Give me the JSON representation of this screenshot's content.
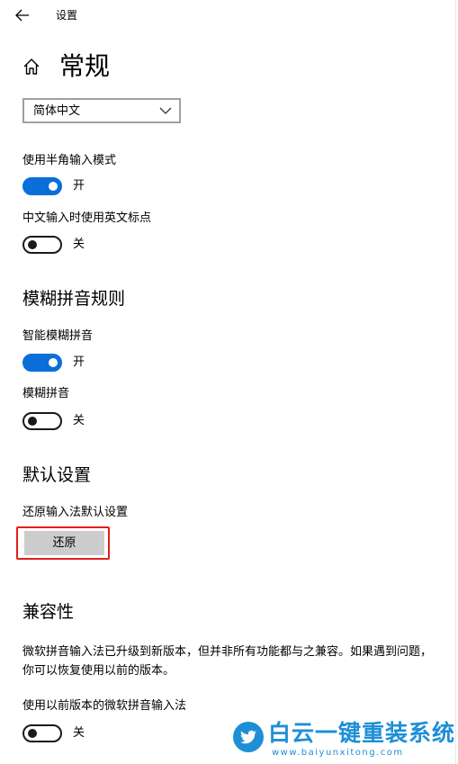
{
  "window": {
    "title": "设置"
  },
  "page": {
    "title": "常规"
  },
  "language_select": {
    "value": "简体中文"
  },
  "settings": [
    {
      "label": "使用半角输入模式",
      "state": "开",
      "on": true
    },
    {
      "label": "中文输入时使用英文标点",
      "state": "关",
      "on": false
    },
    {
      "label": "智能模糊拼音",
      "state": "开",
      "on": true
    },
    {
      "label": "模糊拼音",
      "state": "关",
      "on": false
    },
    {
      "label": "使用以前版本的微软拼音输入法",
      "state": "关",
      "on": false
    }
  ],
  "sections": {
    "fuzzy": "模糊拼音规则",
    "defaults": "默认设置",
    "compat": "兼容性"
  },
  "restore": {
    "label": "还原输入法默认设置",
    "button": "还原"
  },
  "compat_text": "微软拼音输入法已升级到新版本，但并非所有功能都与之兼容。如果遇到问题，你可以恢复使用以前的版本。",
  "watermark": {
    "title": "白云一键重装系统",
    "url": "www.baiyunxitong.com"
  },
  "colors": {
    "accent": "#0a6fd8",
    "highlight": "#e0201c",
    "watermark": "#1e8fd6"
  },
  "icons": [
    "back-arrow-icon",
    "home-icon",
    "chevron-down-icon",
    "twitter-bird-icon"
  ]
}
